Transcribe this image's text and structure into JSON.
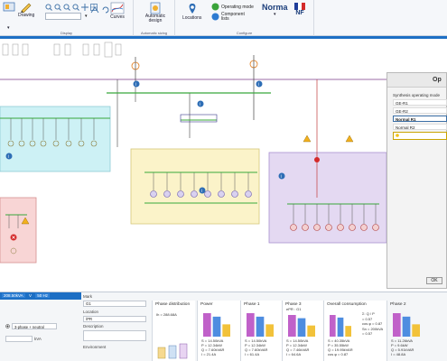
{
  "ribbon": {
    "drawing_label": "Drawing",
    "curves_label": "Curves",
    "display_group": "Display",
    "automatic_design_label": "Automatic design",
    "automatic_sizing_group": "Automatic sizing",
    "locations_label": "Locations",
    "operating_mode_label": "Operating mode",
    "component_lists_label": "Component lists",
    "norma_label": "Norma",
    "nf_label": "NF",
    "configure_group": "Configure"
  },
  "side_panel": {
    "title": "Op",
    "heading": "Synthesis operating mode",
    "items": [
      "GE-R1",
      "GE-R2",
      "Normal R1",
      "Normal R2"
    ],
    "selected_index": 2,
    "ok_label": "OK"
  },
  "bottom": {
    "value_field": "208.50kVA",
    "v_label": "V",
    "freq_field": "50 Hz",
    "mark_label": "Mark",
    "mark_value": "G1",
    "location_label": "Location",
    "location_value": "/PR",
    "description_label": "Description",
    "environment_label": "Environment",
    "phase_distribution_title": "Phase distribution",
    "phase_distribution_value": "Ih = 288.68A",
    "power_title": "Power",
    "phase1_title": "Phase 1",
    "phase2_title": "Phase 2",
    "phase3_title": "Phase 3",
    "supply_title": "ePR : G1",
    "overall_title": "Overall consumption",
    "phase_type": "3-phase + neutral",
    "unit_kva": "kVA",
    "power_legend": [
      "S = 14.50kVA",
      "P = 12.34kW",
      "Q = 7.60kVAR",
      "I = 21.4A"
    ],
    "phase1_legend": [
      "S = 14.50kVA",
      "P = 12.34kW",
      "Q = 7.60kVAR",
      "I = 61.4A"
    ],
    "phase2_legend": [
      "S = 11.26kVA",
      "P = 9.6kW",
      "Q = 5.91kVAR",
      "I = 48.8A"
    ],
    "phase3_legend": [
      "S = 14.50kVA",
      "P = 12.34kW",
      "Q = 7.46kVAR",
      "I = 64.6A"
    ],
    "overall_legend": [
      "S = 40.35kVA",
      "P = 35.55kW",
      "Q = 19.95kVAR",
      "cos φ = 0.87"
    ],
    "overall_right": [
      "Σ: Q / P",
      "= 0.57",
      "cos φ = 0.87",
      "Sn = 200kVA",
      "= 0.57"
    ]
  },
  "colors": {
    "ribbon_accent": "#1d6fc4",
    "zone_cyan": "#ccf2f5",
    "zone_yellow": "#fbf3c9",
    "zone_purple": "#e5d9f2",
    "zone_pink": "#f8d3d3",
    "bus_green": "#38a83a"
  }
}
